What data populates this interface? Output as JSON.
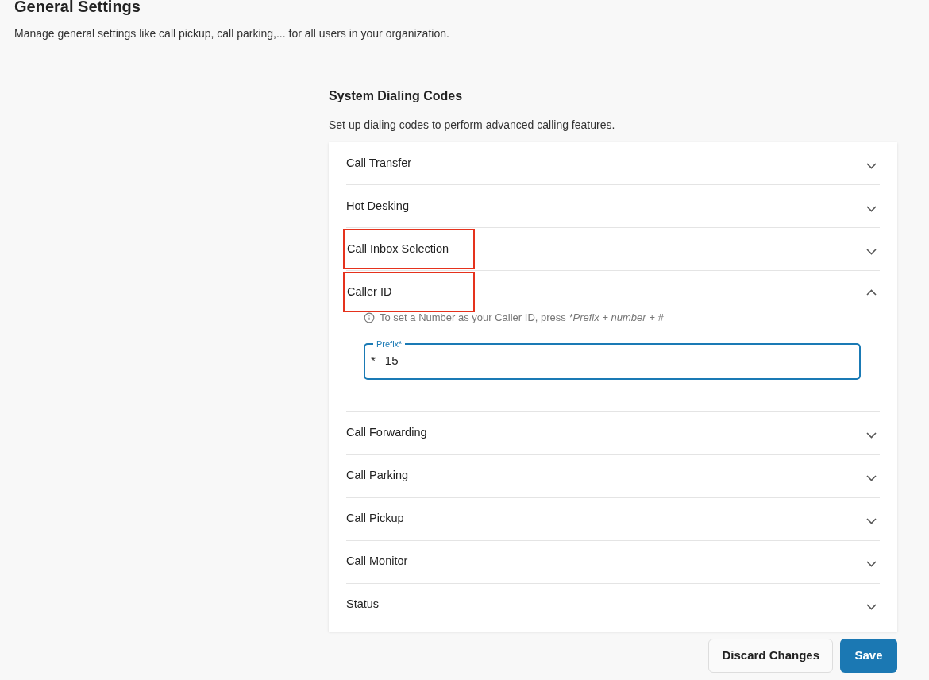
{
  "header": {
    "title": "General Settings",
    "subtitle": "Manage general settings like call pickup, call parking,... for all users in your organization."
  },
  "section": {
    "title": "System Dialing Codes",
    "description": "Set up dialing codes to perform advanced calling features."
  },
  "items": [
    {
      "label": "Call Transfer",
      "expanded": false,
      "highlighted": false
    },
    {
      "label": "Hot Desking",
      "expanded": false,
      "highlighted": false
    },
    {
      "label": "Call Inbox Selection",
      "expanded": false,
      "highlighted": true
    },
    {
      "label": "Caller ID",
      "expanded": true,
      "highlighted": true,
      "hint": "To set a Number as your Caller ID, press",
      "hint_command": "*Prefix + number + #",
      "field": {
        "label": "Prefix*",
        "prefix": "*",
        "value": "15",
        "focused": true
      }
    },
    {
      "label": "Call Forwarding",
      "expanded": false,
      "highlighted": false
    },
    {
      "label": "Call Parking",
      "expanded": false,
      "highlighted": false
    },
    {
      "label": "Call Pickup",
      "expanded": false,
      "highlighted": false
    },
    {
      "label": "Call Monitor",
      "expanded": false,
      "highlighted": false
    },
    {
      "label": "Status",
      "expanded": false,
      "highlighted": false
    }
  ],
  "buttons": {
    "discard": "Discard Changes",
    "save": "Save"
  }
}
